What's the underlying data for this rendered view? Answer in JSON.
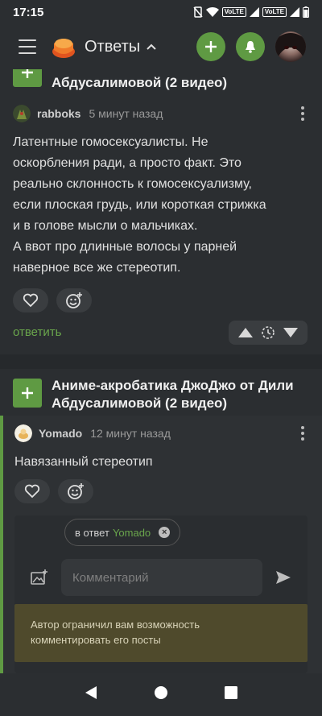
{
  "status": {
    "time": "17:15",
    "volte1": "VoLTE",
    "volte2": "VoLTE"
  },
  "appbar": {
    "title": "Ответы",
    "icons": [
      "menu-icon",
      "app-logo",
      "chevron-up-icon",
      "plus-icon",
      "bell-icon",
      "avatar"
    ]
  },
  "post1": {
    "title_tail": "Абдусалимовой (2 видео)"
  },
  "comment1": {
    "author": "rabboks",
    "time": "5 минут назад",
    "text": [
      "Латентные гомосексуалисты. Не",
      "оскорбления ради, а просто факт. Это",
      "реально склонность к гомосексуализму,",
      "если плоская грудь, или короткая стрижка",
      "и в голове мысли о мальчиках.",
      "А ввот про длинные волосы у парней",
      "наверное все же стереотип."
    ],
    "reply": "ответить"
  },
  "post2": {
    "title_line1": "Аниме-акробатика ДжоДжо от Дили",
    "title_line2": "Абдусалимовой (2 видео)"
  },
  "comment2": {
    "author": "Yomado",
    "time": "12 минут назад",
    "text": "Навязанный стереотип",
    "reply_prefix": "в ответ",
    "reply_user": "Yomado"
  },
  "composer": {
    "placeholder": "Комментарий"
  },
  "restriction": {
    "line1": "Автор ограничил вам возможность",
    "line2": "комментировать его посты"
  },
  "colors": {
    "accent": "#5f9a43",
    "link": "#6aa64c",
    "background": "#2b2e31",
    "notice": "#4f4a2c"
  }
}
